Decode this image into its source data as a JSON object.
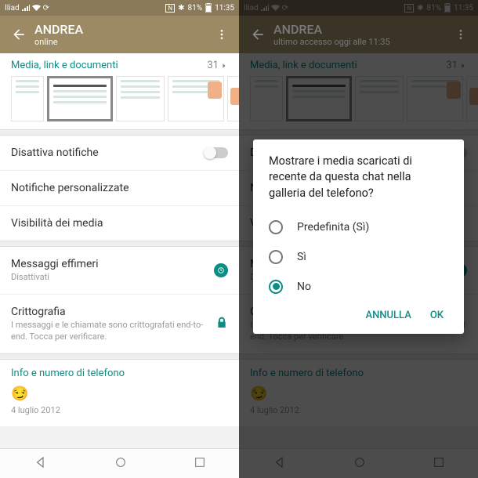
{
  "status": {
    "carrier": "Iliad",
    "nfc": "N",
    "bt": "✱",
    "battery": "81%",
    "time": "11:35"
  },
  "left": {
    "contact": "ANDREA",
    "presence": "online",
    "media_header": "Media, link e documenti",
    "media_count": "31",
    "mute_label": "Disattiva notifiche",
    "custom_notif": "Notifiche personalizzate",
    "media_vis": "Visibilità dei media",
    "ephemeral_label": "Messaggi effimeri",
    "ephemeral_sub": "Disattivati",
    "crypto_label": "Crittografia",
    "crypto_sub": "I messaggi e le chiamate sono crittografati end-to-end. Tocca per verificare.",
    "info_head": "Info e numero di telefono",
    "emoji": "😏",
    "date": "4 luglio 2012"
  },
  "right": {
    "contact": "ANDREA",
    "presence": "ultimo accesso oggi alle 11:35",
    "dialog_title": "Mostrare i media scaricati di recente da questa chat nella galleria del telefono?",
    "opt_default": "Predefinita (Sì)",
    "opt_yes": "Sì",
    "opt_no": "No",
    "cancel": "ANNULLA",
    "ok": "OK"
  }
}
